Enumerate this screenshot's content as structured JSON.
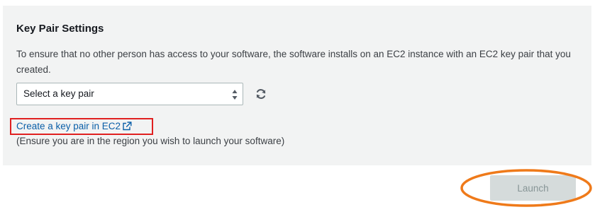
{
  "panel": {
    "title": "Key Pair Settings",
    "description": "To ensure that no other person has access to your software, the software installs on an EC2 instance with an EC2 key pair that you created."
  },
  "key_pair_select": {
    "selected_value": "Select a key pair"
  },
  "refresh": {
    "icon": "refresh-icon"
  },
  "create_link": {
    "label": "Create a key pair in EC2",
    "icon": "external-link-icon"
  },
  "region_note": "(Ensure you are in the region you wish to launch your software)",
  "launch_button": {
    "label": "Launch",
    "disabled": true
  },
  "colors": {
    "panel_background": "#f2f3f3",
    "link": "#0a5fa8",
    "annotation_box": "#e02020",
    "annotation_ellipse": "#ef7a1a",
    "launch_disabled_bg": "#d5dbdb",
    "launch_disabled_text": "#879596"
  }
}
